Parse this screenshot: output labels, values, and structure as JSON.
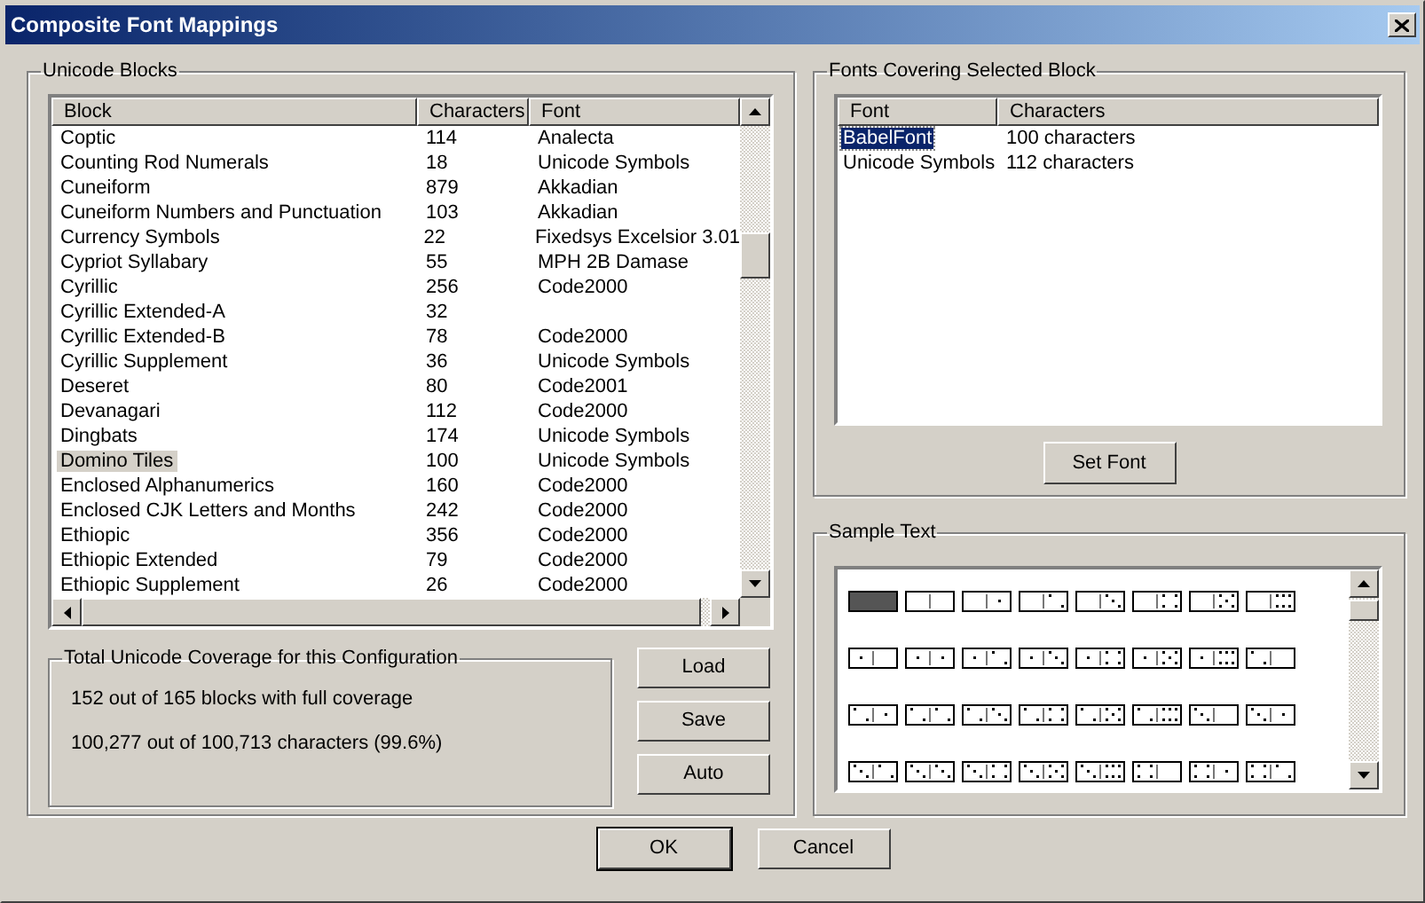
{
  "window": {
    "title": "Composite Font Mappings"
  },
  "unicode_blocks": {
    "title": "Unicode Blocks",
    "columns": [
      "Block",
      "Characters",
      "Font"
    ],
    "rows": [
      {
        "block": "Coptic",
        "characters": "114",
        "font": "Analecta",
        "selected": false
      },
      {
        "block": "Counting Rod Numerals",
        "characters": "18",
        "font": "Unicode Symbols",
        "selected": false
      },
      {
        "block": "Cuneiform",
        "characters": "879",
        "font": "Akkadian",
        "selected": false
      },
      {
        "block": "Cuneiform Numbers and Punctuation",
        "characters": "103",
        "font": "Akkadian",
        "selected": false
      },
      {
        "block": "Currency Symbols",
        "characters": "22",
        "font": "Fixedsys Excelsior 3.01",
        "selected": false
      },
      {
        "block": "Cypriot Syllabary",
        "characters": "55",
        "font": "MPH 2B Damase",
        "selected": false
      },
      {
        "block": "Cyrillic",
        "characters": "256",
        "font": "Code2000",
        "selected": false
      },
      {
        "block": "Cyrillic Extended-A",
        "characters": "32",
        "selected": false
      },
      {
        "block": "Cyrillic Extended-B",
        "characters": "78",
        "font": "Code2000",
        "selected": false
      },
      {
        "block": "Cyrillic Supplement",
        "characters": "36",
        "font": "Unicode Symbols",
        "selected": false
      },
      {
        "block": "Deseret",
        "characters": "80",
        "font": "Code2001",
        "selected": false
      },
      {
        "block": "Devanagari",
        "characters": "112",
        "font": "Code2000",
        "selected": false
      },
      {
        "block": "Dingbats",
        "characters": "174",
        "font": "Unicode Symbols",
        "selected": false
      },
      {
        "block": "Domino Tiles",
        "characters": "100",
        "font": "Unicode Symbols",
        "selected": true
      },
      {
        "block": "Enclosed Alphanumerics",
        "characters": "160",
        "font": "Code2000",
        "selected": false
      },
      {
        "block": "Enclosed CJK Letters and Months",
        "characters": "242",
        "font": "Code2000",
        "selected": false
      },
      {
        "block": "Ethiopic",
        "characters": "356",
        "font": "Code2000",
        "selected": false
      },
      {
        "block": "Ethiopic Extended",
        "characters": "79",
        "font": "Code2000",
        "selected": false
      },
      {
        "block": "Ethiopic Supplement",
        "characters": "26",
        "font": "Code2000",
        "selected": false
      }
    ]
  },
  "coverage": {
    "title": "Total Unicode Coverage for this Configuration",
    "lines": [
      "152 out of 165 blocks with full coverage",
      "100,277 out of 100,713 characters (99.6%)"
    ]
  },
  "side_buttons": [
    "Load",
    "Save",
    "Auto"
  ],
  "fonts_covering": {
    "title": "Fonts Covering Selected Block",
    "columns": [
      "Font",
      "Characters"
    ],
    "rows": [
      {
        "font": "BabelFont",
        "characters": "100 characters",
        "selected": true
      },
      {
        "font": "Unicode Symbols",
        "characters": "112 characters",
        "selected": false
      }
    ],
    "button": "Set Font"
  },
  "sample_text": {
    "title": "Sample Text"
  },
  "dialog_buttons": [
    {
      "label": "OK",
      "default": true
    },
    {
      "label": "Cancel",
      "default": false
    }
  ]
}
